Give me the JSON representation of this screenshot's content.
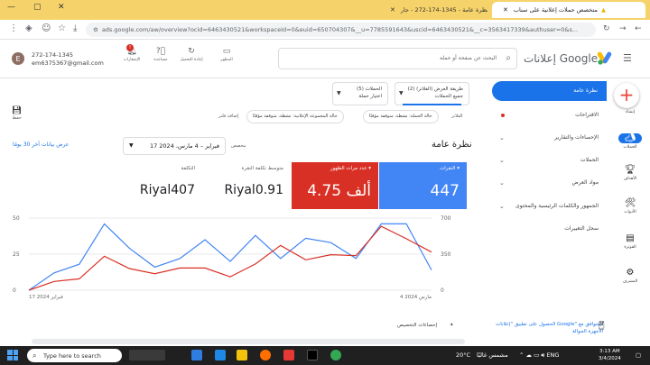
{
  "browser": {
    "tabs": [
      {
        "label": "متخصص حملات إعلانية على سناب",
        "active": false
      },
      {
        "label": "نظرة عامة - 1345-174-272 - جار",
        "active": true
      },
      {
        "label": "جار",
        "active": false
      }
    ],
    "url": "ads.google.com/aw/overview?ocid=6463430521&workspaceId=0&euid=650704307&__u=7785591643&uscid=6463430521&__c=3563417339&authuser=0&s..."
  },
  "header": {
    "account_id": "272-174-1345",
    "account_email": "em6375367@gmail.com",
    "avatar_letter": "E",
    "icons": [
      {
        "name": "appearance",
        "label": "المظهر"
      },
      {
        "name": "refresh",
        "label": "إعادة التحميل"
      },
      {
        "name": "help",
        "label": "مساعدة"
      },
      {
        "name": "notifications",
        "label": "الإشعارات",
        "badge": "!"
      }
    ],
    "search_placeholder": "البحث عن صفحة أو حملة",
    "brand": "إعلانات Google"
  },
  "rail": [
    {
      "icon": "create",
      "label": "إنشاء"
    },
    {
      "icon": "campaigns",
      "label": "الحملات"
    },
    {
      "icon": "goals",
      "label": "الأهداف"
    },
    {
      "icon": "tools",
      "label": "الأدوات"
    },
    {
      "icon": "billing",
      "label": "الفوترة"
    },
    {
      "icon": "admin",
      "label": "المشرف"
    }
  ],
  "nav": {
    "active": "نظرة عامة",
    "items": [
      {
        "label": "الاقتراحات",
        "dot": true
      },
      {
        "label": "الإحصاءات والتقارير",
        "chev": true
      },
      {
        "label": "الحملات",
        "chev": true
      },
      {
        "label": "مواد العرض",
        "chev": true
      },
      {
        "label": "الجمهور والكلمات الرئيسية والمحتوى",
        "chev": true
      },
      {
        "label": "سجل التغييرات",
        "chev": false
      }
    ],
    "promo": "الحصول على تطبيق \"إعلانات Google\" المتوافق مع الأجهزة الجوالة"
  },
  "filters": {
    "view_line1": "طريقة العرض (الفلاتر) (2)",
    "view_line2": "جميع الحملات",
    "campaigns_line1": "الحملات (5)",
    "campaigns_line2": "اختيار حملة",
    "label": "الفلاتر",
    "chip1": "حالة الحملة: نشطة، متوقفة مؤقتًا",
    "chip2": "حالة المجموعة الإعلانية: نشطة، متوقفة مؤقتًا",
    "add_filter": "إضافة فلتر",
    "save": "حفظ"
  },
  "overview": {
    "title": "نظرة عامة",
    "custom_label": "مخصص",
    "date_range": "17 فبراير – 4 مارس، 2024",
    "show_last": "عرض بيانات آخر 30 يومًا"
  },
  "scorecards": [
    {
      "title": "النقرات",
      "value": "447",
      "style": "blue"
    },
    {
      "title": "عدد مرات الظهور",
      "value": "4.75 ألف",
      "style": "red"
    },
    {
      "title": "متوسط تكلفة النقرة",
      "value": "Riyal0.91",
      "style": "plain"
    },
    {
      "title": "التكلفة",
      "value": "Riyal407",
      "style": "plain"
    }
  ],
  "chart_data": {
    "type": "line",
    "x_start_label": "17 فبراير 2024",
    "x_end_label": "4 مارس 2024",
    "left_axis_ticks": [
      "50",
      "25",
      "0"
    ],
    "right_axis_ticks": [
      "700",
      "350",
      "0"
    ],
    "series": [
      {
        "name": "النقرات",
        "color": "#4285f4",
        "axis": "left",
        "values": [
          0,
          12,
          18,
          46,
          29,
          16,
          22,
          35,
          20,
          38,
          22,
          36,
          33,
          22,
          46,
          46,
          14
        ]
      },
      {
        "name": "عدد مرات الظهور",
        "color": "#d93025",
        "axis": "right",
        "values": [
          0,
          85,
          110,
          330,
          210,
          160,
          215,
          215,
          130,
          255,
          435,
          295,
          345,
          335,
          620,
          500,
          370
        ]
      }
    ],
    "ylim_left": [
      0,
      50
    ],
    "ylim_right": [
      0,
      700
    ]
  },
  "footer": {
    "insights": "إحصاءات التخصيص"
  },
  "taskbar": {
    "search": "Type here to search",
    "weather": "20°C",
    "weather_text": "مشمس غالبًا",
    "time": "3:13 AM",
    "date": "3/4/2024"
  }
}
